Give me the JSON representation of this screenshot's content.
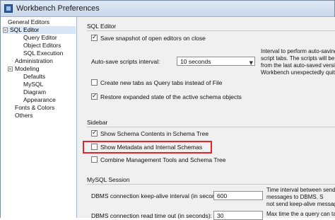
{
  "window": {
    "title": "Workbench Preferences",
    "icon": "workbench-app-icon"
  },
  "sidebar": {
    "items": [
      {
        "label": "General Editors"
      },
      {
        "label": "SQL Editor",
        "expanded": true,
        "selected": true
      },
      {
        "label": "Query Editor"
      },
      {
        "label": "Object Editors"
      },
      {
        "label": "SQL Execution"
      },
      {
        "label": "Administration"
      },
      {
        "label": "Modeling",
        "expanded": true
      },
      {
        "label": "Defaults"
      },
      {
        "label": "MySQL"
      },
      {
        "label": "Diagram"
      },
      {
        "label": "Appearance"
      },
      {
        "label": "Fonts & Colors"
      },
      {
        "label": "Others"
      }
    ]
  },
  "sql_editor": {
    "title": "SQL Editor",
    "save_snapshot": {
      "label": "Save snapshot of open editors on close",
      "checked": true
    },
    "auto_save": {
      "label": "Auto-save scripts interval:",
      "value": "10 seconds"
    },
    "auto_save_help": [
      "Interval to perform auto-saving",
      "script tabs. The scripts will be",
      "from the last auto-saved version",
      "Workbench unexpectedly quits."
    ],
    "new_tabs": {
      "label": "Create new tabs as Query tabs instead of File",
      "checked": false
    },
    "restore_state": {
      "label": "Restore expanded state of the active schema objects",
      "checked": true
    }
  },
  "sidebar_section": {
    "title": "Sidebar",
    "show_schema_contents": {
      "label": "Show Schema Contents in Schema Tree",
      "checked": true
    },
    "show_metadata": {
      "label": "Show Metadata and Internal Schemas",
      "checked": false
    },
    "combine_tools": {
      "label": "Combine Management Tools and Schema Tree",
      "checked": false
    }
  },
  "mysql_session": {
    "title": "MySQL Session",
    "keepalive": {
      "label": "DBMS connection keep-alive interval (in seconds):",
      "value": "600"
    },
    "keepalive_help": [
      "Time interval between sendin",
      "messages to DBMS. S",
      "not send keep-alive messages"
    ],
    "read_timeout": {
      "label": "DBMS connection read time out (in seconds):",
      "value": "30"
    },
    "read_timeout_help": [
      "Max time the a query can take"
    ]
  },
  "colors": {
    "highlight": "#e0262c",
    "selection": "#d8e7f8"
  }
}
